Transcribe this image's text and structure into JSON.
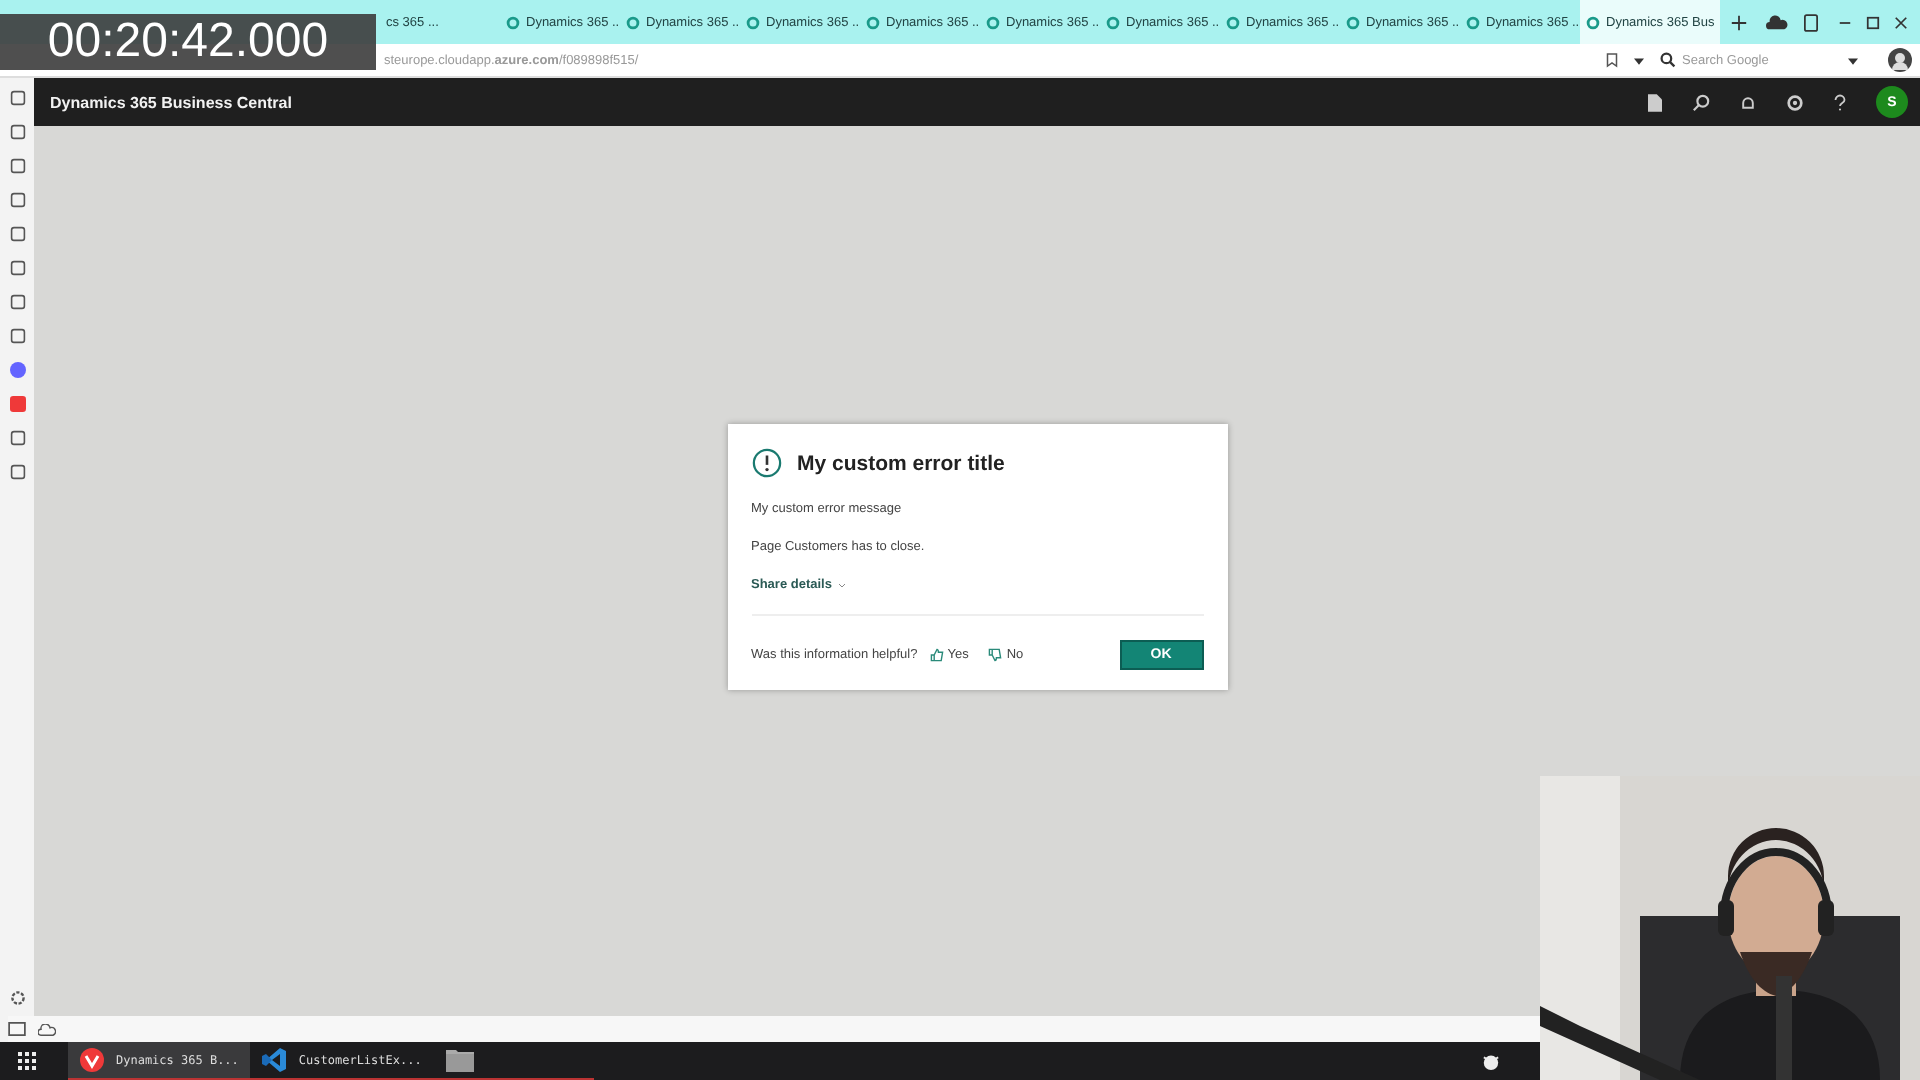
{
  "timer": "00:20:42.000",
  "browser": {
    "tabs": [
      {
        "label": "cs 365 ...",
        "selected": false
      },
      {
        "label": "Dynamics 365 ...",
        "selected": false
      },
      {
        "label": "Dynamics 365 ...",
        "selected": false
      },
      {
        "label": "Dynamics 365 ...",
        "selected": false
      },
      {
        "label": "Dynamics 365 ...",
        "selected": false
      },
      {
        "label": "Dynamics 365 ...",
        "selected": false
      },
      {
        "label": "Dynamics 365 ...",
        "selected": false
      },
      {
        "label": "Dynamics 365 ...",
        "selected": false
      },
      {
        "label": "Dynamics 365 ...",
        "selected": false
      },
      {
        "label": "Dynamics 365 ...",
        "selected": false
      },
      {
        "label": "Dynamics 365 Bus",
        "selected": true
      }
    ],
    "address": "steurope.cloudapp.**azure.com**/f089898f515/",
    "search": {
      "placeholder": "Search Google"
    }
  },
  "app": {
    "title": "Dynamics 365 Business Central",
    "avatar": "S"
  },
  "dialog": {
    "title": "My custom error title",
    "message": "My custom error message",
    "close_note": "Page Customers has to close.",
    "share_details": "Share details",
    "feedback_prompt": "Was this information helpful?",
    "yes": "Yes",
    "no": "No",
    "ok": "OK"
  },
  "taskbar": {
    "items": [
      {
        "kind": "browser",
        "label": "Dynamics 365 B...",
        "selected": true
      },
      {
        "kind": "editor",
        "label": "CustomerListEx...",
        "selected": false
      },
      {
        "kind": "folder",
        "selected": false
      }
    ]
  }
}
